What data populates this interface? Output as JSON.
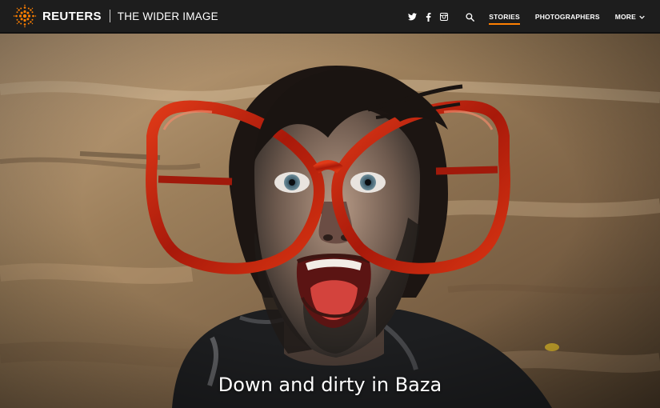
{
  "header": {
    "brand_name": "REUTERS",
    "brand_sub": "THE WIDER IMAGE",
    "social_icons": [
      "twitter-icon",
      "facebook-icon",
      "instagram-icon"
    ],
    "search_icon": "search-icon",
    "nav": [
      {
        "label": "STORIES",
        "active": true
      },
      {
        "label": "PHOTOGRAPHERS",
        "active": false
      },
      {
        "label": "MORE",
        "active": false
      }
    ],
    "accent": "#ff8000"
  },
  "hero": {
    "title": "Down and dirty in Baza"
  }
}
